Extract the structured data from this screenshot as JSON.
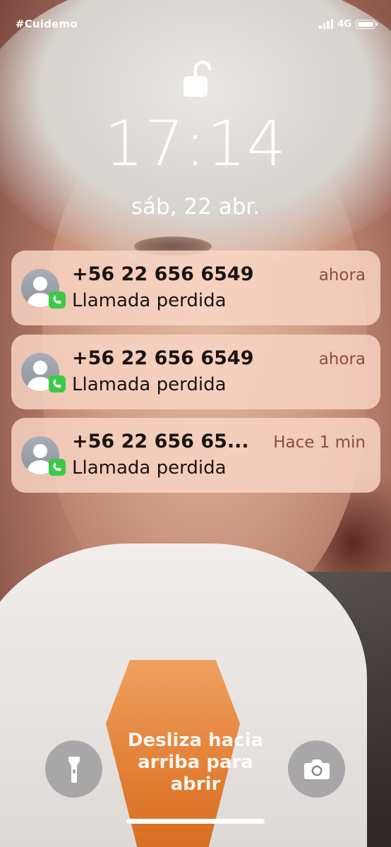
{
  "status_bar": {
    "carrier": "#Cuidemo",
    "network": "4G"
  },
  "lock_screen": {
    "time": "17:14",
    "date": "sáb, 22 abr."
  },
  "notifications": [
    {
      "title": "+56 22 656 6549",
      "body": "Llamada perdida",
      "time": "ahora"
    },
    {
      "title": "+56 22 656 6549",
      "body": "Llamada perdida",
      "time": "ahora"
    },
    {
      "title": "+56 22 656 65...",
      "body": "Llamada perdida",
      "time": "Hace 1 min"
    }
  ],
  "bottom": {
    "hint": "Desliza hacia arriba para abrir",
    "left_button_icon": "flashlight-icon",
    "right_button_icon": "camera-icon"
  }
}
